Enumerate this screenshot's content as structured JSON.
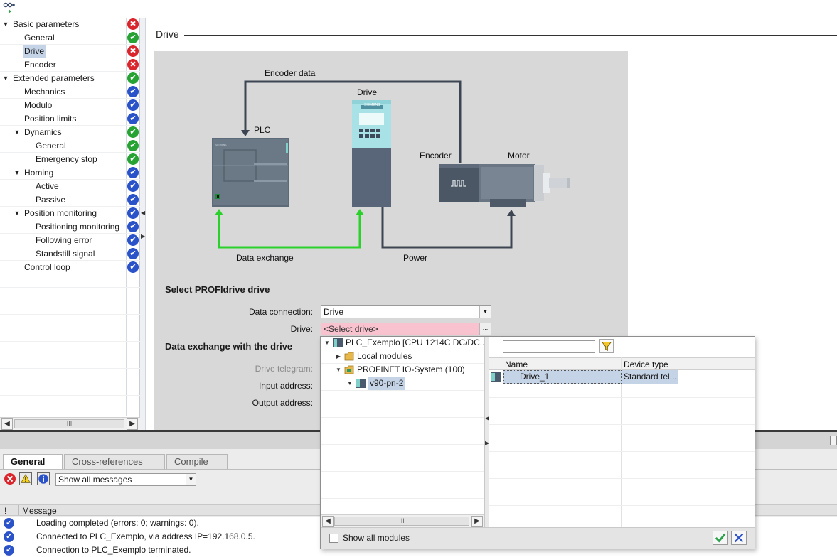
{
  "nav": {
    "items": [
      {
        "label": "Basic parameters",
        "level": 0,
        "expand": "open",
        "status": "error"
      },
      {
        "label": "General",
        "level": 1,
        "expand": "",
        "status": "ok"
      },
      {
        "label": "Drive",
        "level": 1,
        "expand": "",
        "status": "error",
        "selected": true
      },
      {
        "label": "Encoder",
        "level": 1,
        "expand": "",
        "status": "error"
      },
      {
        "label": "Extended parameters",
        "level": 0,
        "expand": "open",
        "status": "ok"
      },
      {
        "label": "Mechanics",
        "level": 1,
        "expand": "",
        "status": "info"
      },
      {
        "label": "Modulo",
        "level": 1,
        "expand": "",
        "status": "info"
      },
      {
        "label": "Position limits",
        "level": 1,
        "expand": "",
        "status": "info"
      },
      {
        "label": "Dynamics",
        "level": 1,
        "expand": "open",
        "status": "ok"
      },
      {
        "label": "General",
        "level": 2,
        "expand": "",
        "status": "ok"
      },
      {
        "label": "Emergency stop",
        "level": 2,
        "expand": "",
        "status": "ok"
      },
      {
        "label": "Homing",
        "level": 1,
        "expand": "open",
        "status": "info"
      },
      {
        "label": "Active",
        "level": 2,
        "expand": "",
        "status": "info"
      },
      {
        "label": "Passive",
        "level": 2,
        "expand": "",
        "status": "info"
      },
      {
        "label": "Position monitoring",
        "level": 1,
        "expand": "open",
        "status": "info"
      },
      {
        "label": "Positioning monitoring",
        "level": 2,
        "expand": "",
        "status": "info"
      },
      {
        "label": "Following error",
        "level": 2,
        "expand": "",
        "status": "info"
      },
      {
        "label": "Standstill signal",
        "level": 2,
        "expand": "",
        "status": "info"
      },
      {
        "label": "Control loop",
        "level": 1,
        "expand": "",
        "status": "info"
      }
    ],
    "scroll_thumb": "III"
  },
  "main": {
    "heading": "Drive",
    "diagram": {
      "encoder_data": "Encoder data",
      "drive": "Drive",
      "plc": "PLC",
      "encoder": "Encoder",
      "motor": "Motor",
      "data_exchange": "Data exchange",
      "power": "Power",
      "brand": "SIEMENS"
    },
    "select_section": "Select PROFIdrive drive",
    "data_connection_label": "Data connection:",
    "data_connection_value": "Drive",
    "drive_label": "Drive:",
    "drive_value": "<Select drive>",
    "drive_browse": "...",
    "exchange_section": "Data exchange with the drive",
    "drive_telegram_label": "Drive telegram:",
    "input_address_label": "Input address:",
    "output_address_label": "Output address:"
  },
  "popup": {
    "tree": [
      {
        "label": "PLC_Exemplo [CPU 1214C DC/DC...",
        "expand": "open"
      },
      {
        "label": "Local modules",
        "expand": "closed"
      },
      {
        "label": "PROFINET IO-System (100)",
        "expand": "open"
      },
      {
        "label": "v90-pn-2",
        "expand": "open"
      }
    ],
    "search_value": "",
    "columns": [
      "Name",
      "Device type"
    ],
    "rows": [
      {
        "name": "Drive_1",
        "type": "Standard tel..."
      }
    ],
    "show_all_label": "Show all modules",
    "show_all_checked": false,
    "scroll_thumb": "III"
  },
  "bottom": {
    "tabs": [
      "General",
      "Cross-references",
      "Compile"
    ],
    "filter_value": "Show all messages",
    "col_bang": "!",
    "col_message": "Message",
    "messages": [
      "Loading completed (errors: 0; warnings: 0).",
      "Connected to PLC_Exemplo, via address IP=192.168.0.5.",
      "Connection to PLC_Exemplo terminated."
    ]
  },
  "colors": {
    "error": "#d9252b",
    "ok": "#27a334",
    "info": "#2a52c9",
    "data_exchange_line": "#2ad12a",
    "drive_required": "#f8c3cf",
    "selection": "#c5d3e6"
  }
}
